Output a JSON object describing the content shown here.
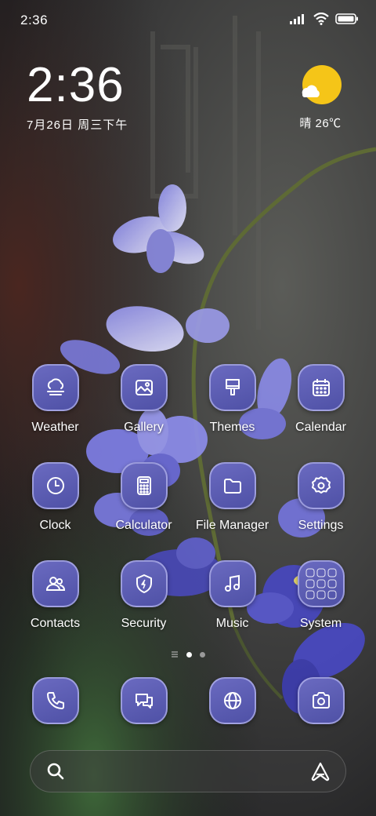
{
  "status_bar": {
    "time": "2:36",
    "icons": [
      "signal-icon",
      "wifi-icon",
      "battery-icon"
    ]
  },
  "clock_widget": {
    "time": "2:36",
    "date": "7月26日 周三下午"
  },
  "weather_widget": {
    "condition_icon": "sun-cloud-icon",
    "text": "晴 26℃"
  },
  "apps": [
    {
      "label": "Weather",
      "icon": "weather-icon"
    },
    {
      "label": "Gallery",
      "icon": "gallery-icon"
    },
    {
      "label": "Themes",
      "icon": "themes-icon"
    },
    {
      "label": "Calendar",
      "icon": "calendar-icon"
    },
    {
      "label": "Clock",
      "icon": "clock-icon"
    },
    {
      "label": "Calculator",
      "icon": "calculator-icon"
    },
    {
      "label": "File Manager",
      "icon": "folder-icon"
    },
    {
      "label": "Settings",
      "icon": "settings-icon"
    },
    {
      "label": "Contacts",
      "icon": "contacts-icon"
    },
    {
      "label": "Security",
      "icon": "shield-icon"
    },
    {
      "label": "Music",
      "icon": "music-icon"
    },
    {
      "label": "System",
      "icon": "folder-grid-icon"
    }
  ],
  "page_indicator": {
    "pages": 2,
    "current": 1
  },
  "dock": [
    {
      "icon": "phone-icon"
    },
    {
      "icon": "messages-icon"
    },
    {
      "icon": "browser-icon"
    },
    {
      "icon": "camera-icon"
    }
  ],
  "search_bar": {
    "left_icon": "search-icon",
    "right_icon": "assistant-icon"
  },
  "colors": {
    "tile": "#5a5cb4",
    "tile_border": "#d2d2ff",
    "weather_sun": "#f5c518",
    "flower": "#6a6ad8"
  }
}
